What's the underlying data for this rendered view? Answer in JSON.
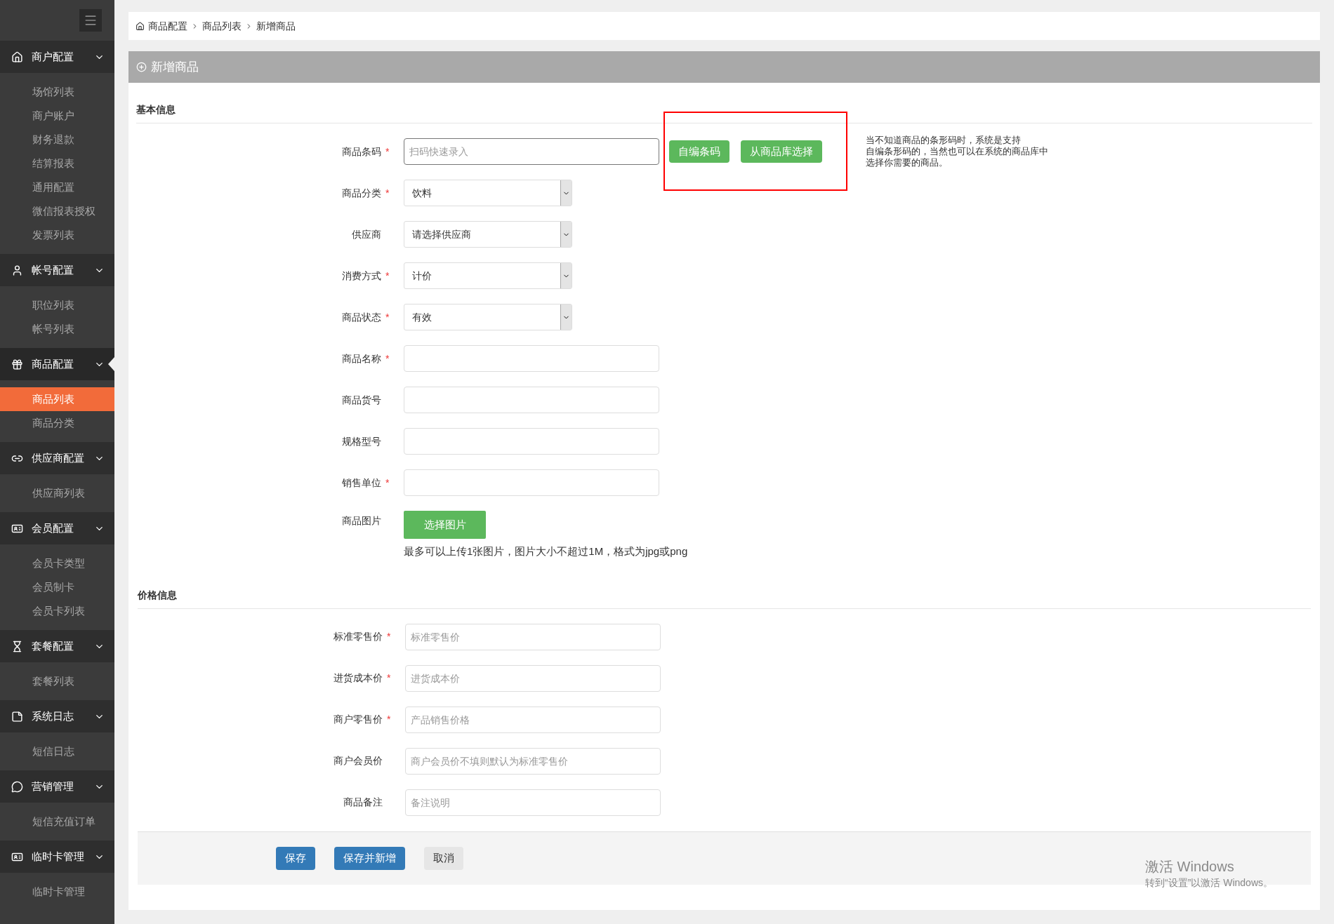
{
  "sidebar": {
    "groups": [
      {
        "label": "商户配置",
        "expanded": true,
        "selected": false,
        "items": [
          {
            "label": "场馆列表",
            "selected": false
          },
          {
            "label": "商户账户",
            "selected": false
          },
          {
            "label": "财务退款",
            "selected": false
          },
          {
            "label": "结算报表",
            "selected": false
          },
          {
            "label": "通用配置",
            "selected": false
          },
          {
            "label": "微信报表授权",
            "selected": false
          },
          {
            "label": "发票列表",
            "selected": false
          }
        ]
      },
      {
        "label": "帐号配置",
        "expanded": true,
        "selected": false,
        "items": [
          {
            "label": "职位列表",
            "selected": false
          },
          {
            "label": "帐号列表",
            "selected": false
          }
        ]
      },
      {
        "label": "商品配置",
        "expanded": true,
        "selected": true,
        "items": [
          {
            "label": "商品列表",
            "selected": true
          },
          {
            "label": "商品分类",
            "selected": false
          }
        ]
      },
      {
        "label": "供应商配置",
        "expanded": true,
        "selected": false,
        "items": [
          {
            "label": "供应商列表",
            "selected": false
          }
        ]
      },
      {
        "label": "会员配置",
        "expanded": true,
        "selected": false,
        "items": [
          {
            "label": "会员卡类型",
            "selected": false
          },
          {
            "label": "会员制卡",
            "selected": false
          },
          {
            "label": "会员卡列表",
            "selected": false
          }
        ]
      },
      {
        "label": "套餐配置",
        "expanded": true,
        "selected": false,
        "items": [
          {
            "label": "套餐列表",
            "selected": false
          }
        ]
      },
      {
        "label": "系统日志",
        "expanded": true,
        "selected": false,
        "items": [
          {
            "label": "短信日志",
            "selected": false
          }
        ]
      },
      {
        "label": "营销管理",
        "expanded": true,
        "selected": false,
        "items": [
          {
            "label": "短信充值订单",
            "selected": false
          }
        ]
      },
      {
        "label": "临时卡管理",
        "expanded": true,
        "selected": false,
        "items": [
          {
            "label": "临时卡管理",
            "selected": false
          }
        ]
      }
    ]
  },
  "required_mark": "*",
  "breadcrumb": [
    "商品配置",
    "商品列表",
    "新增商品"
  ],
  "panel_title": "新增商品",
  "sections": [
    {
      "title": "基本信息",
      "fields": [
        {
          "kind": "input",
          "label": "商品条码",
          "required": true,
          "placeholder": "扫码快速录入",
          "focused": true,
          "actions": {
            "highlighted": true,
            "buttons": [
              "自编条码",
              "从商品库选择"
            ]
          },
          "help": [
            "当不知道商品的条形码时，系统是支持",
            "自编条形码的，当然也可以在系统的商品库中",
            "选择你需要的商品。"
          ]
        },
        {
          "kind": "select",
          "label": "商品分类",
          "required": true,
          "value": "饮料"
        },
        {
          "kind": "select",
          "label": "供应商",
          "required": false,
          "value": "请选择供应商"
        },
        {
          "kind": "select",
          "label": "消费方式",
          "required": true,
          "value": "计价"
        },
        {
          "kind": "select",
          "label": "商品状态",
          "required": true,
          "value": "有效"
        },
        {
          "kind": "input",
          "label": "商品名称",
          "required": true,
          "focused": false
        },
        {
          "kind": "input",
          "label": "商品货号",
          "required": false,
          "focused": false
        },
        {
          "kind": "input",
          "label": "规格型号",
          "required": false,
          "focused": false
        },
        {
          "kind": "input",
          "label": "销售单位",
          "required": true,
          "focused": false
        },
        {
          "kind": "upload",
          "label": "商品图片",
          "required": false,
          "button": "选择图片",
          "note": "最多可以上传1张图片，图片大小不超过1M，格式为jpg或png"
        }
      ]
    },
    {
      "title": "价格信息",
      "fields": [
        {
          "kind": "input",
          "label": "标准零售价",
          "required": true,
          "placeholder": "标准零售价",
          "focused": false
        },
        {
          "kind": "input",
          "label": "进货成本价",
          "required": true,
          "placeholder": "进货成本价",
          "focused": false
        },
        {
          "kind": "input",
          "label": "商户零售价",
          "required": true,
          "placeholder": "产品销售价格",
          "focused": false
        },
        {
          "kind": "input",
          "label": "商户会员价",
          "required": false,
          "placeholder": "商户会员价不填则默认为标准零售价",
          "focused": false
        },
        {
          "kind": "input",
          "label": "商品备注",
          "required": false,
          "placeholder": "备注说明",
          "focused": false
        }
      ]
    }
  ],
  "footer_buttons": [
    {
      "label": "保存",
      "kind": "primary"
    },
    {
      "label": "保存并新增",
      "kind": "primary"
    },
    {
      "label": "取消",
      "kind": "default"
    }
  ],
  "os_notice": {
    "title": "激活 Windows",
    "subtitle": "转到“设置”以激活 Windows。"
  }
}
